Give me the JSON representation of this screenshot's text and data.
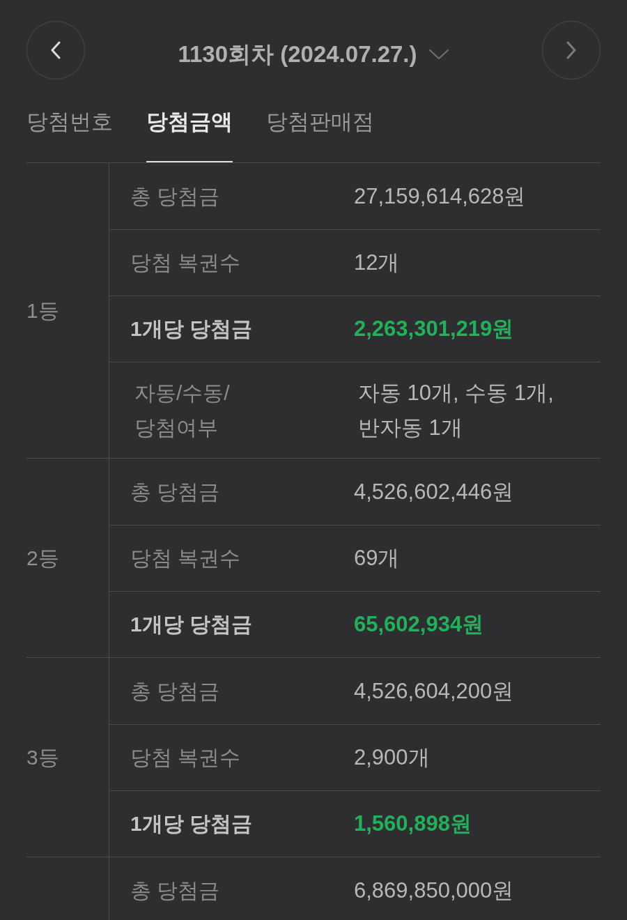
{
  "header": {
    "prev_button": {
      "disabled": false
    },
    "title": "1130회차 (2024.07.27.)",
    "next_button": {
      "disabled": true
    }
  },
  "tabs": [
    {
      "label": "당첨번호",
      "selected": false
    },
    {
      "label": "당첨금액",
      "selected": true
    },
    {
      "label": "당첨판매점",
      "selected": false
    }
  ],
  "prize_table": [
    {
      "rank": "1등",
      "rows": [
        {
          "kind": "amount",
          "label": "총 당첨금",
          "value": "27,159,614,628원"
        },
        {
          "kind": "count",
          "label": "당첨 복권수",
          "value": "12개"
        },
        {
          "kind": "per_ticket",
          "label": "1개당 당첨금",
          "value": "2,263,301,219원"
        },
        {
          "kind": "method",
          "label": "자동/수동/\n당첨여부",
          "value": "자동 10개, 수동 1개,\n반자동 1개"
        }
      ]
    },
    {
      "rank": "2등",
      "rows": [
        {
          "kind": "amount",
          "label": "총 당첨금",
          "value": "4,526,602,446원"
        },
        {
          "kind": "count",
          "label": "당첨 복권수",
          "value": "69개"
        },
        {
          "kind": "per_ticket",
          "label": "1개당 당첨금",
          "value": "65,602,934원"
        }
      ]
    },
    {
      "rank": "3등",
      "rows": [
        {
          "kind": "amount",
          "label": "총 당첨금",
          "value": "4,526,604,200원"
        },
        {
          "kind": "count",
          "label": "당첨 복권수",
          "value": "2,900개"
        },
        {
          "kind": "per_ticket",
          "label": "1개당 당첨금",
          "value": "1,560,898원"
        }
      ]
    },
    {
      "rows": [
        {
          "kind": "amount",
          "label": "총 당첨금",
          "value": "6,869,850,000원"
        }
      ]
    }
  ]
}
